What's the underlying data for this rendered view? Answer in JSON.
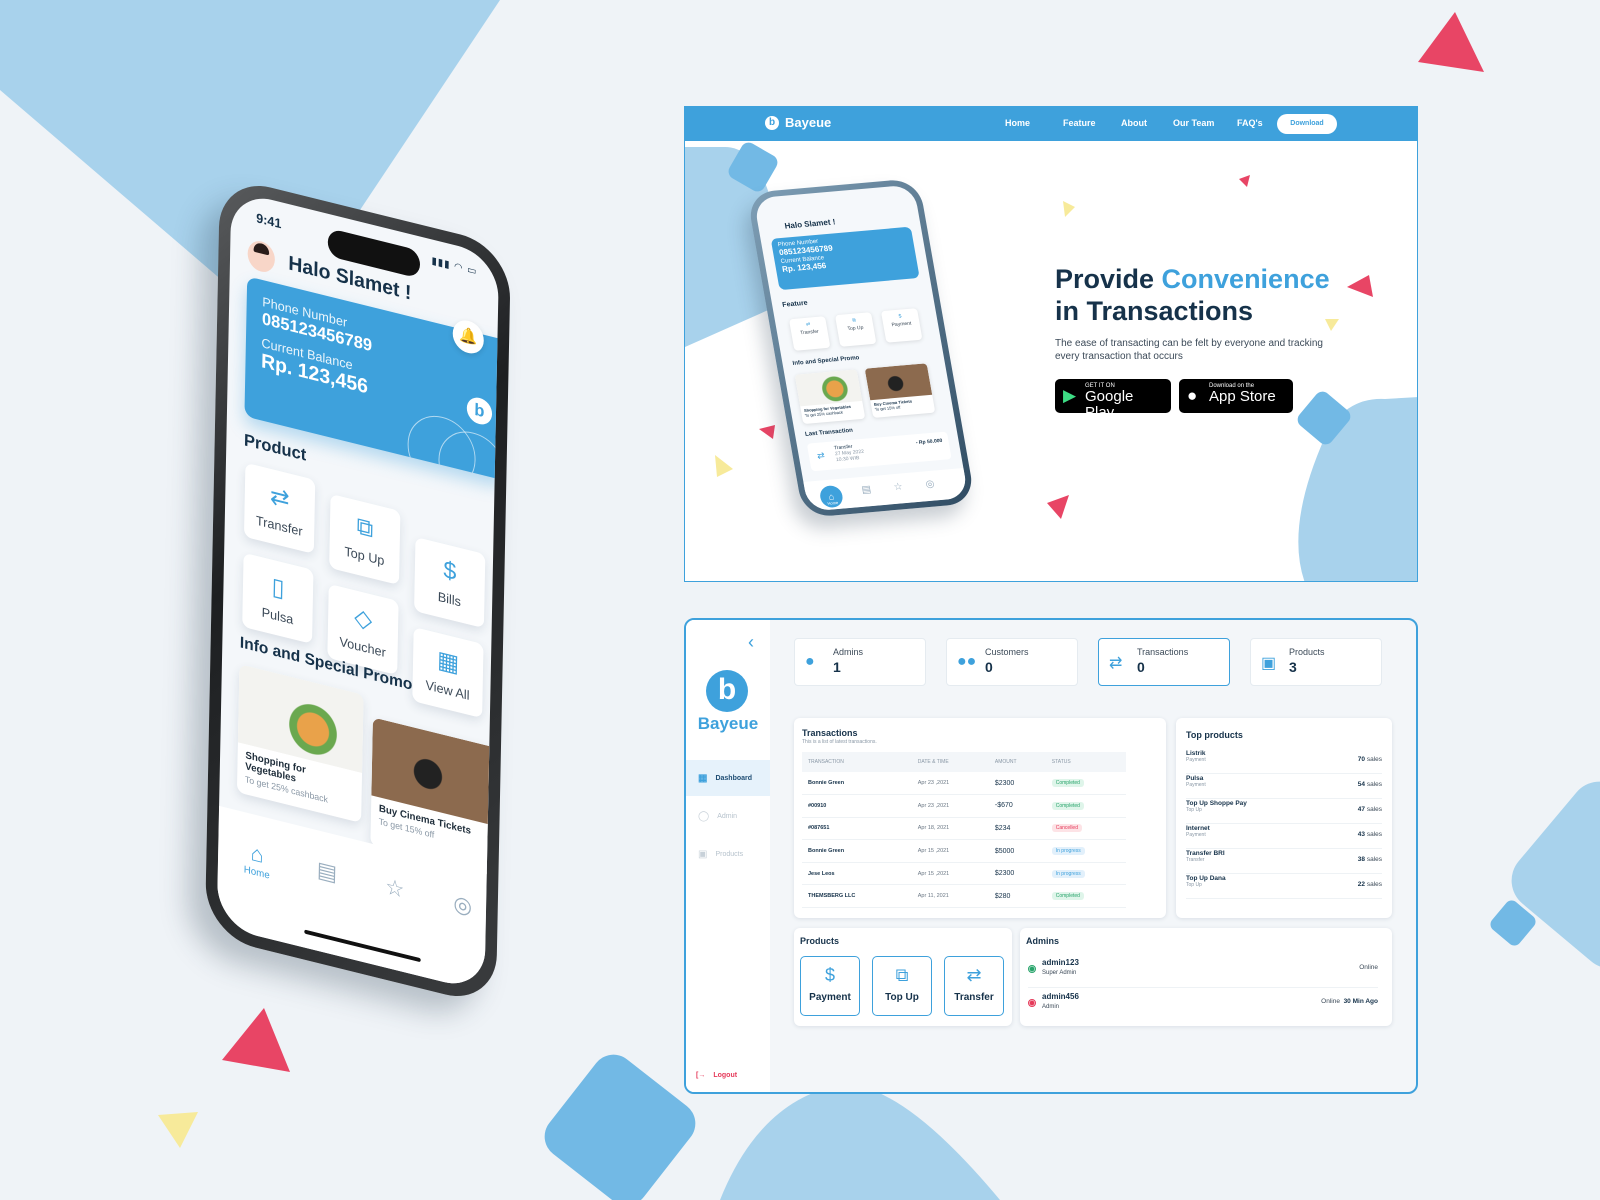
{
  "colors": {
    "accent": "#3ea1dc",
    "dark": "#16324a",
    "danger": "#e53a5a",
    "success": "#28a46b",
    "background": "#eff3f7"
  },
  "mobile": {
    "time": "9:41",
    "greeting": "Halo Slamet !",
    "card": {
      "phone_label": "Phone Number",
      "phone_value": "085123456789",
      "balance_label": "Current Balance",
      "balance_value": "Rp. 123,456",
      "logo": "b"
    },
    "product_title": "Product",
    "products": [
      {
        "label": "Transfer",
        "icon": "transfer-icon"
      },
      {
        "label": "Top Up",
        "icon": "top-up-icon"
      },
      {
        "label": "Bills",
        "icon": "bills-icon"
      },
      {
        "label": "Pulsa",
        "icon": "phone-icon"
      },
      {
        "label": "Voucher",
        "icon": "tag-icon"
      },
      {
        "label": "View All",
        "icon": "grid-icon"
      }
    ],
    "promo_title": "Info and Special Promo",
    "promos": [
      {
        "title": "Shopping for Vegetables",
        "subtitle": "To get 25% cashback"
      },
      {
        "title": "Buy Cinema Tickets",
        "subtitle": "To get 15% off"
      }
    ],
    "nav": [
      {
        "label": "Home",
        "icon": "home-icon"
      },
      {
        "label": "",
        "icon": "receipt-icon"
      },
      {
        "label": "",
        "icon": "star-icon"
      },
      {
        "label": "",
        "icon": "profile-icon"
      }
    ]
  },
  "landing": {
    "brand": "Bayeue",
    "menu": [
      "Home",
      "Feature",
      "About",
      "Our Team",
      "FAQ's"
    ],
    "download": "Download",
    "title_part1": "Provide ",
    "title_accent": "Convenience",
    "title_part2": "in Transactions",
    "subtitle": "The ease of transacting can be felt by everyone and tracking every transaction that occurs",
    "google_small": "GET IT ON",
    "google_big": "Google Play",
    "apple_small": "Download on the",
    "apple_big": "App Store",
    "mini": {
      "greeting": "Halo Slamet !",
      "phone_label": "Phone Number",
      "phone_value": "085123456789",
      "balance_label": "Current Balance",
      "balance_value": "Rp. 123,456",
      "feature_title": "Feature",
      "features": [
        "Transfer",
        "Top Up",
        "Payment"
      ],
      "promo_title": "Info and Special Promo",
      "promos": [
        {
          "title": "Shopping for Vegetables",
          "subtitle": "To get 25% cashback"
        },
        {
          "title": "Buy Cinema Tickets",
          "subtitle": "To get 15% off"
        }
      ],
      "last_title": "Last Transaction",
      "last_name": "Transfer",
      "last_date": "27 May 2022",
      "last_time": "10:30 WIB",
      "last_amount": "- Rp 50.000",
      "home_label": "Home"
    }
  },
  "dashboard": {
    "brand": "Bayeue",
    "logo": "b",
    "menu": [
      {
        "label": "Dashboard",
        "active": true
      },
      {
        "label": "Admin",
        "active": false
      },
      {
        "label": "Products",
        "active": false
      }
    ],
    "logout": "Logout",
    "stats": [
      {
        "label": "Admins",
        "value": "1"
      },
      {
        "label": "Customers",
        "value": "0"
      },
      {
        "label": "Transactions",
        "value": "0"
      },
      {
        "label": "Products",
        "value": "3"
      }
    ],
    "transactions": {
      "title": "Transactions",
      "subtitle": "This is a list of latest transactions.",
      "headers": [
        "TRANSACTION",
        "DATE & TIME",
        "AMOUNT",
        "STATUS"
      ],
      "rows": [
        {
          "name": "Bonnie Green",
          "date": "Apr 23 ,2021",
          "amount": "$2300",
          "status": "Completed"
        },
        {
          "name": "#00910",
          "date": "Apr 23 ,2021",
          "amount": "-$670",
          "status": "Completed"
        },
        {
          "name": "#087651",
          "date": "Apr 18, 2021",
          "amount": "$234",
          "status": "Cancelled"
        },
        {
          "name": "Bonnie Green",
          "date": "Apr 15 ,2021",
          "amount": "$5000",
          "status": "In progress"
        },
        {
          "name": "Jese Leos",
          "date": "Apr 15 ,2021",
          "amount": "$2300",
          "status": "In progress"
        },
        {
          "name": "THEMSBERG LLC",
          "date": "Apr 11, 2021",
          "amount": "$280",
          "status": "Completed"
        }
      ]
    },
    "top_products": {
      "title": "Top products",
      "items": [
        {
          "name": "Listrik",
          "category": "Payment",
          "sales": "70",
          "unit": "sales"
        },
        {
          "name": "Pulsa",
          "category": "Payment",
          "sales": "54",
          "unit": "sales"
        },
        {
          "name": "Top Up Shoppe Pay",
          "category": "Top Up",
          "sales": "47",
          "unit": "sales"
        },
        {
          "name": "Internet",
          "category": "Payment",
          "sales": "43",
          "unit": "sales"
        },
        {
          "name": "Transfer BRI",
          "category": "Transfer",
          "sales": "38",
          "unit": "sales"
        },
        {
          "name": "Top Up Dana",
          "category": "Top Up",
          "sales": "22",
          "unit": "sales"
        }
      ]
    },
    "products": {
      "title": "Products",
      "items": [
        {
          "label": "Payment",
          "icon": "bills-icon"
        },
        {
          "label": "Top Up",
          "icon": "top-up-icon"
        },
        {
          "label": "Transfer",
          "icon": "transfer-icon"
        }
      ]
    },
    "admins": {
      "title": "Admins",
      "items": [
        {
          "name": "admin123",
          "role": "Super Admin",
          "status": "Online",
          "extra": ""
        },
        {
          "name": "admin456",
          "role": "Admin",
          "status": "Online",
          "extra": "30 Min Ago"
        }
      ]
    }
  }
}
